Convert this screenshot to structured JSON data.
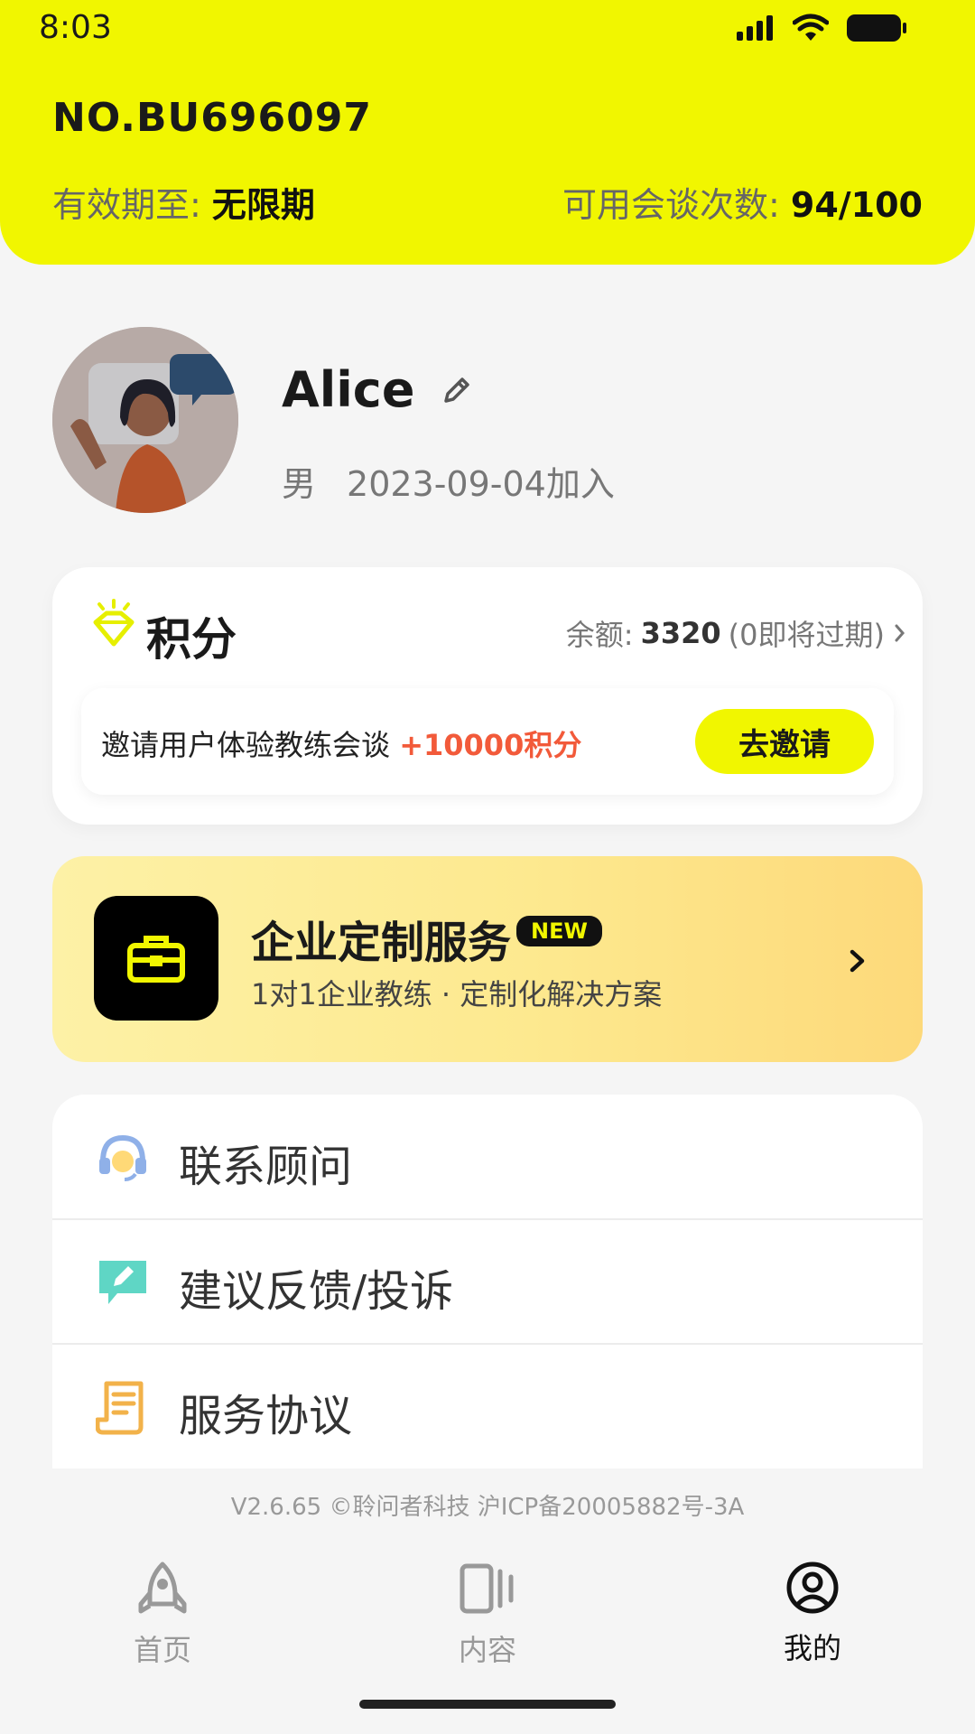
{
  "status_bar": {
    "time": "8:03"
  },
  "header": {
    "member_no": "NO.BU696097",
    "validity_label": "有效期至: ",
    "validity_value": "无限期",
    "sessions_label": "可用会谈次数: ",
    "sessions_value": "94/100"
  },
  "profile": {
    "name": "Alice",
    "gender": "男",
    "joined": "2023-09-04加入"
  },
  "points": {
    "title": "积分",
    "balance_label": "余额:",
    "balance_value": "3320",
    "balance_note": "(0即将过期)",
    "invite_text": "邀请用户体验教练会谈 ",
    "invite_bonus": "+10000积分",
    "invite_button": "去邀请"
  },
  "enterprise": {
    "title": "企业定制服务",
    "badge": "NEW",
    "subtitle": "1对1企业教练 · 定制化解决方案"
  },
  "menu": {
    "items": [
      {
        "label": "联系顾问",
        "icon": "headset-icon"
      },
      {
        "label": "建议反馈/投诉",
        "icon": "feedback-icon"
      },
      {
        "label": "服务协议",
        "icon": "document-icon"
      }
    ]
  },
  "footer": {
    "note": "V2.6.65 ©聆问者科技  沪ICP备20005882号-3A"
  },
  "tabbar": {
    "items": [
      {
        "label": "首页",
        "icon": "rocket-icon"
      },
      {
        "label": "内容",
        "icon": "cards-icon"
      },
      {
        "label": "我的",
        "icon": "user-icon",
        "active": true
      }
    ]
  },
  "colors": {
    "brand_yellow": "#f1f600",
    "bonus_red": "#f25a3a"
  }
}
